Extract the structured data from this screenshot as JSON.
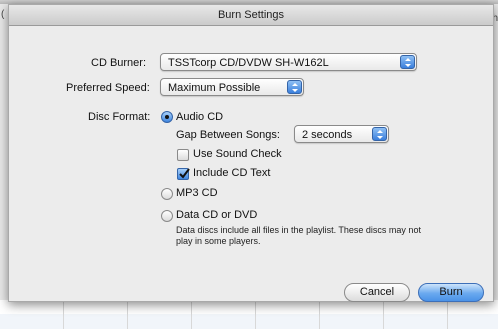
{
  "window": {
    "title": "Burn Settings"
  },
  "background": {
    "left_char": "(",
    "right_char": "h"
  },
  "cd_burner": {
    "label": "CD Burner:",
    "value": "TSSTcorp CD/DVDW SH-W162L"
  },
  "preferred_speed": {
    "label": "Preferred Speed:",
    "value": "Maximum Possible"
  },
  "disc_format": {
    "label": "Disc Format:",
    "audio_cd": {
      "label": "Audio CD",
      "selected": true,
      "gap_label": "Gap Between Songs:",
      "gap_value": "2 seconds",
      "use_sound_check": {
        "label": "Use Sound Check",
        "checked": false
      },
      "include_cd_text": {
        "label": "Include CD Text",
        "checked": true
      }
    },
    "mp3_cd": {
      "label": "MP3 CD",
      "selected": false
    },
    "data_cd": {
      "label": "Data CD or DVD",
      "selected": false,
      "note": "Data discs include all files in the playlist. These discs may not play in some players."
    }
  },
  "buttons": {
    "cancel": "Cancel",
    "burn": "Burn"
  },
  "colors": {
    "accent": "#3f86e0",
    "sheet_bg": "#ececec"
  }
}
